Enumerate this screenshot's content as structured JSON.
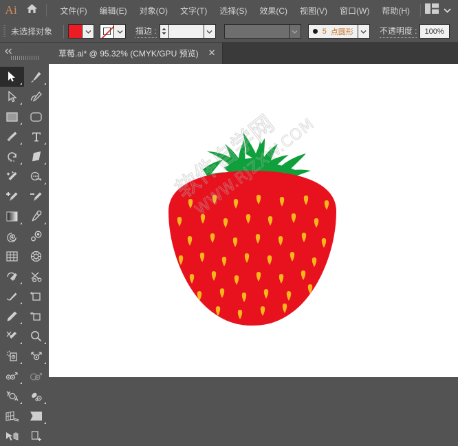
{
  "app": {
    "name": "Ai",
    "logo_color": "#cf8b5a",
    "home_icon": "home-icon"
  },
  "menubar": {
    "items": [
      {
        "label": "文件(F)",
        "name": "menu-file"
      },
      {
        "label": "编辑(E)",
        "name": "menu-edit"
      },
      {
        "label": "对象(O)",
        "name": "menu-object"
      },
      {
        "label": "文字(T)",
        "name": "menu-type"
      },
      {
        "label": "选择(S)",
        "name": "menu-select"
      },
      {
        "label": "效果(C)",
        "name": "menu-effect"
      },
      {
        "label": "视图(V)",
        "name": "menu-view"
      },
      {
        "label": "窗口(W)",
        "name": "menu-window"
      },
      {
        "label": "帮助(H)",
        "name": "menu-help"
      }
    ],
    "workspace_switcher_icon": "workspace-grid-icon",
    "workspace_chevron_icon": "chevron-down-icon"
  },
  "control_bar": {
    "selection_status": "未选择对象",
    "fill": {
      "label_name": "fill-swatch",
      "color": "#ed1c24"
    },
    "fill_dropdown_icon": "chevron-down-icon",
    "stroke_swatch": {
      "label_name": "stroke-swatch",
      "value": "none"
    },
    "stroke_dropdown_icon": "chevron-down-icon",
    "stroke_label": "描边 :",
    "stroke_width_value": "",
    "stroke_width_dropdown_icon": "chevron-down-icon",
    "variable_width_value": "",
    "variable_width_dropdown_icon": "chevron-down-icon",
    "brush_profile": {
      "dot_icon": "round-dot-icon",
      "number": "5",
      "text": "点圆形",
      "dropdown_icon": "chevron-down-icon"
    },
    "opacity_label": "不透明度 :",
    "opacity_value": "100%"
  },
  "tab_bar": {
    "collapse_icon": "double-chevron-left-icon",
    "panel_grip": "drag-grip",
    "document": {
      "title": "草莓.ai* @ 95.32% (CMYK/GPU 预览)",
      "close_icon": "close-icon"
    }
  },
  "toolbar": {
    "tools": [
      {
        "name": "selection-tool",
        "label": "选择工具",
        "active": true,
        "corner": true
      },
      {
        "name": "pen-tool",
        "label": "钢笔工具",
        "active": false,
        "corner": true
      },
      {
        "name": "direct-selection-tool",
        "label": "直接选择工具",
        "active": false,
        "corner": true
      },
      {
        "name": "curvature-tool",
        "label": "曲率工具",
        "active": false,
        "corner": false
      },
      {
        "name": "rectangle-tool",
        "label": "矩形工具",
        "active": false,
        "corner": true
      },
      {
        "name": "rounded-rectangle-tool",
        "label": "圆角矩形工具",
        "active": false,
        "corner": false
      },
      {
        "name": "paintbrush-tool",
        "label": "画笔工具",
        "active": false,
        "corner": true
      },
      {
        "name": "type-tool",
        "label": "文字工具",
        "active": false,
        "corner": true
      },
      {
        "name": "rotate-tool",
        "label": "旋转工具",
        "active": false,
        "corner": true
      },
      {
        "name": "eraser-tool",
        "label": "橡皮擦工具",
        "active": false,
        "corner": true
      },
      {
        "name": "magic-wand-tool",
        "label": "魔棒工具",
        "active": false,
        "corner": false
      },
      {
        "name": "shape-builder-tool",
        "label": "形状生成器工具",
        "active": false,
        "corner": true
      },
      {
        "name": "add-anchor-point-tool",
        "label": "添加锚点工具",
        "active": false,
        "corner": false
      },
      {
        "name": "delete-anchor-point-tool",
        "label": "删除锚点工具",
        "active": false,
        "corner": false
      },
      {
        "name": "gradient-tool",
        "label": "渐变工具",
        "active": false,
        "corner": true
      },
      {
        "name": "eyedropper-tool",
        "label": "吸管工具",
        "active": false,
        "corner": true
      },
      {
        "name": "spiral-tool",
        "label": "螺旋线工具",
        "active": false,
        "corner": false
      },
      {
        "name": "blend-tool",
        "label": "混合工具",
        "active": false,
        "corner": false
      },
      {
        "name": "grid-tool",
        "label": "网格工具",
        "active": false,
        "corner": false
      },
      {
        "name": "live-paint-bucket-tool",
        "label": "实时上色工具",
        "active": false,
        "corner": false
      },
      {
        "name": "shaper-tool",
        "label": "Shaper 工具",
        "active": false,
        "corner": true
      },
      {
        "name": "scissors-tool",
        "label": "剪刀工具",
        "active": false,
        "corner": false
      },
      {
        "name": "width-tool",
        "label": "宽度工具",
        "active": false,
        "corner": true
      },
      {
        "name": "free-transform-tool",
        "label": "自由变换工具",
        "active": false,
        "corner": false
      },
      {
        "name": "pencil-tool",
        "label": "铅笔工具",
        "active": false,
        "corner": true
      },
      {
        "name": "artboard-tool",
        "label": "画板工具",
        "active": false,
        "corner": false
      },
      {
        "name": "slice-tool",
        "label": "切片工具",
        "active": false,
        "corner": true
      },
      {
        "name": "zoom-tool",
        "label": "缩放工具",
        "active": false,
        "corner": true
      },
      {
        "name": "symbol-sprayer-tool",
        "label": "符号喷枪工具",
        "active": false,
        "corner": true
      },
      {
        "name": "scale-tool",
        "label": "比例缩放工具",
        "active": false,
        "corner": true
      },
      {
        "name": "warp-tool",
        "label": "变形工具",
        "active": false,
        "corner": true
      },
      {
        "name": "reshape-tool",
        "label": "整形工具",
        "active": false,
        "corner": false
      },
      {
        "name": "rotate-view-tool",
        "label": "旋转视图工具",
        "active": false,
        "corner": true
      },
      {
        "name": "puppet-warp-tool",
        "label": "操控变形工具",
        "active": false,
        "corner": true
      },
      {
        "name": "perspective-grid-tool",
        "label": "透视网格工具",
        "active": false,
        "corner": false
      },
      {
        "name": "column-graph-tool",
        "label": "柱形图工具",
        "active": false,
        "corner": true
      },
      {
        "name": "perspective-selection-tool",
        "label": "透视选区工具",
        "active": false,
        "corner": false
      },
      {
        "name": "artboard-add-tool",
        "label": "新建画板",
        "active": false,
        "corner": false
      }
    ]
  },
  "canvas": {
    "background": "#ffffff",
    "artwork": {
      "name": "strawberry-illustration",
      "body_color": "#e8121f",
      "leaf_color": "#0fa03c",
      "seed_color": "#f7b71c"
    },
    "watermark": {
      "line1": "软件自学网",
      "line2": "WWW.RJZXW.COM",
      "color": "#c9c9c9"
    }
  }
}
